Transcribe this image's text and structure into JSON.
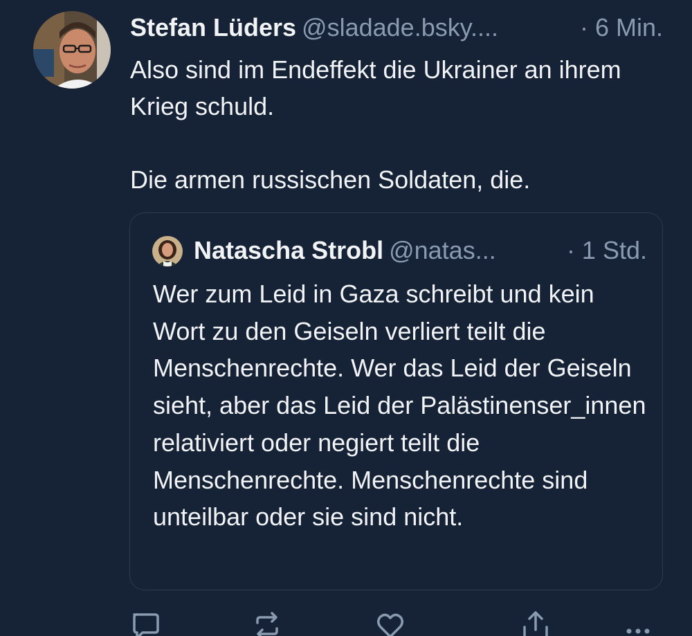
{
  "post": {
    "author": {
      "name": "Stefan Lüders",
      "handle": "@sladade.bsky....",
      "avatar_icon": "user-photo-avatar"
    },
    "time": "· 6 Min.",
    "paragraphs": [
      "Also sind im Endeffekt die Ukrainer an ihrem Krieg schuld.",
      "Die armen russischen Soldaten, die."
    ],
    "quote": {
      "author": {
        "name": "Natascha Strobl",
        "handle": "@natas...",
        "avatar_icon": "user-photo-avatar"
      },
      "time": "· 1 Std.",
      "text": "Wer zum Leid in Gaza schreibt und kein Wort zu den Geiseln verliert teilt die Menschenrechte. Wer das Leid der Geiseln sieht, aber das Leid der Palästinenser_innen relativiert oder negiert teilt die Menschenrechte. Menschenrechte sind unteilbar oder sie sind nicht."
    },
    "actions": [
      {
        "icon": "reply-icon"
      },
      {
        "icon": "repost-icon"
      },
      {
        "icon": "like-icon"
      },
      {
        "icon": "share-icon"
      },
      {
        "icon": "more-icon"
      }
    ]
  },
  "colors": {
    "background": "#162337",
    "text_primary": "#f1f3f5",
    "text_secondary": "#8a9bb0",
    "border": "#2b3a4f"
  }
}
